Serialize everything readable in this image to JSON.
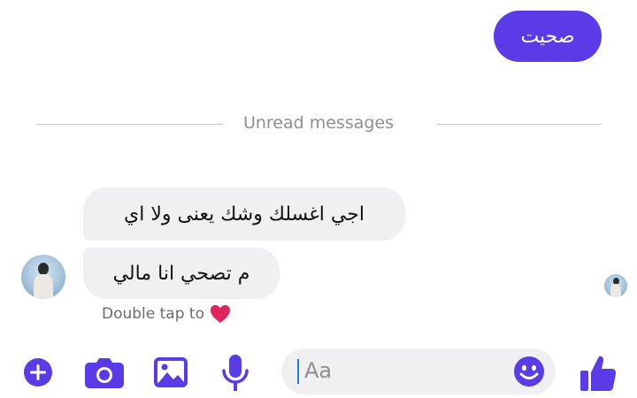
{
  "colors": {
    "accent": "#5b3be8",
    "sent_bubble_text": "#ffffff",
    "received_bubble": "#f0f0f3",
    "divider": "#c4c4c9",
    "heart": "#e0245e"
  },
  "conversation": {
    "sent_messages": [
      {
        "text": "صحيت"
      }
    ],
    "divider_label": "Unread messages",
    "received_messages": [
      {
        "text": "اجي اغسلك وشك يعنى ولا اي"
      },
      {
        "text": "م تصحي انا مالي"
      }
    ],
    "reaction_hint": {
      "text": "Double tap to",
      "icon": "heart-icon"
    }
  },
  "composer": {
    "actions": [
      "plus-icon",
      "camera-icon",
      "image-icon",
      "microphone-icon"
    ],
    "input": {
      "placeholder": "Aa",
      "value": ""
    },
    "emoji_icon": "emoji-icon",
    "send_icon": "thumbs-up-icon"
  }
}
